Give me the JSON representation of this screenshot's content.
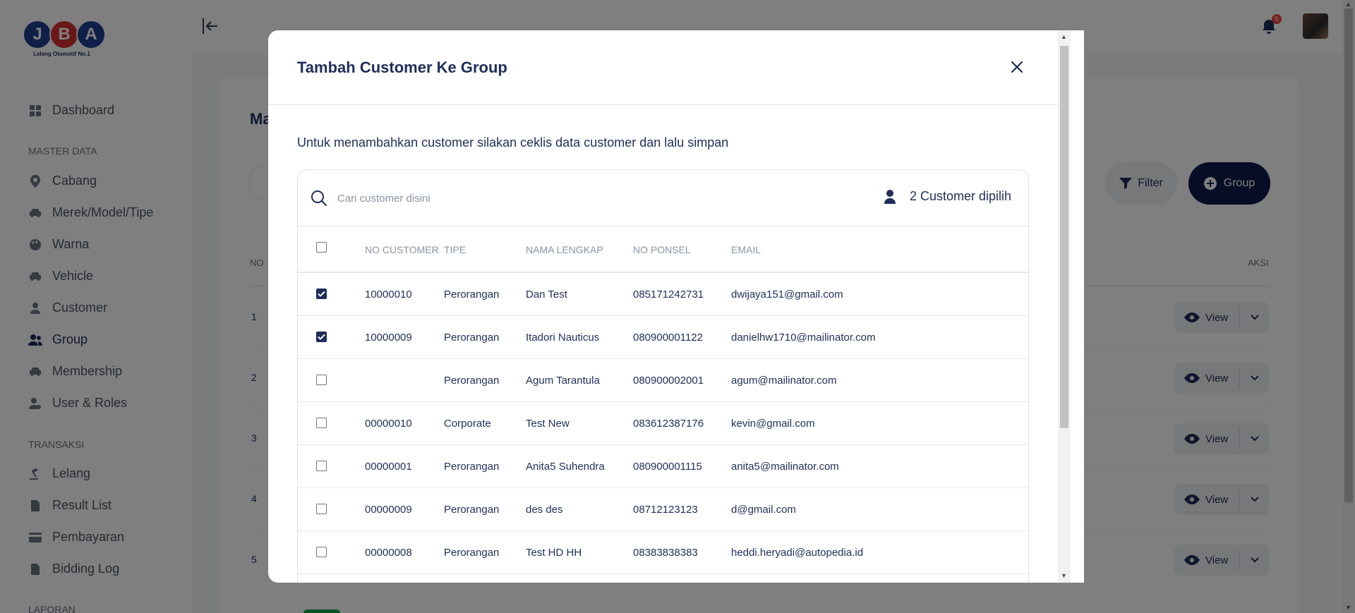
{
  "logo": {
    "letters": [
      "J",
      "B",
      "A"
    ],
    "tagline": "Lelang Otomotif No.1"
  },
  "sidebar": {
    "items": [
      {
        "label": "Dashboard"
      },
      {
        "label": "Cabang"
      },
      {
        "label": "Merek/Model/Tipe"
      },
      {
        "label": "Warna"
      },
      {
        "label": "Vehicle"
      },
      {
        "label": "Customer"
      },
      {
        "label": "Group"
      },
      {
        "label": "Membership"
      },
      {
        "label": "User & Roles"
      },
      {
        "label": "Lelang"
      },
      {
        "label": "Result List"
      },
      {
        "label": "Pembayaran"
      },
      {
        "label": "Bidding Log"
      }
    ],
    "section_master": "MASTER DATA",
    "section_transaksi": "TRANSAKSI",
    "section_laporan": "LAPORAN"
  },
  "header": {
    "notification_count": "5"
  },
  "page": {
    "title_partial": "Ma",
    "filter_label": "Filter",
    "add_group_label": "Group",
    "col_no": "NO",
    "col_aksi": "AKSI",
    "row_numbers": [
      "1",
      "2",
      "3",
      "4",
      "5"
    ],
    "view_label": "View"
  },
  "modal": {
    "title": "Tambah Customer Ke Group",
    "description": "Untuk menambahkan customer silakan ceklis data customer dan lalu simpan",
    "search_placeholder": "Cari customer disini",
    "selected_count_text": "2 Customer dipilih",
    "columns": {
      "no_customer": "NO CUSTOMER",
      "tipe": "TIPE",
      "nama_lengkap": "NAMA LENGKAP",
      "no_ponsel": "NO PONSEL",
      "email": "EMAIL"
    },
    "rows": [
      {
        "checked": true,
        "no_customer": "10000010",
        "tipe": "Perorangan",
        "nama": "Dan Test",
        "ponsel": "085171242731",
        "email": "dwijaya151@gmail.com"
      },
      {
        "checked": true,
        "no_customer": "10000009",
        "tipe": "Perorangan",
        "nama": "Itadori Nauticus",
        "ponsel": "080900001122",
        "email": "danielhw1710@mailinator.com"
      },
      {
        "checked": false,
        "no_customer": "",
        "tipe": "Perorangan",
        "nama": "Agum Tarantula",
        "ponsel": "080900002001",
        "email": "agum@mailinator.com"
      },
      {
        "checked": false,
        "no_customer": "00000010",
        "tipe": "Corporate",
        "nama": "Test New",
        "ponsel": "083612387176",
        "email": "kevin@gmail.com"
      },
      {
        "checked": false,
        "no_customer": "00000001",
        "tipe": "Perorangan",
        "nama": "Anita5 Suhendra",
        "ponsel": "080900001115",
        "email": "anita5@mailinator.com"
      },
      {
        "checked": false,
        "no_customer": "00000009",
        "tipe": "Perorangan",
        "nama": "des des",
        "ponsel": "08712123123",
        "email": "d@gmail.com"
      },
      {
        "checked": false,
        "no_customer": "00000008",
        "tipe": "Perorangan",
        "nama": "Test HD HH",
        "ponsel": "08383838383",
        "email": "heddi.heryadi@autopedia.id"
      }
    ]
  },
  "colors": {
    "primary": "#1f2d5a",
    "button_dark": "#0d1a4a",
    "logo_blue": "#1f3f8f",
    "logo_red": "#d32f2f",
    "overlay": "rgba(0,0,0,0.5)"
  }
}
